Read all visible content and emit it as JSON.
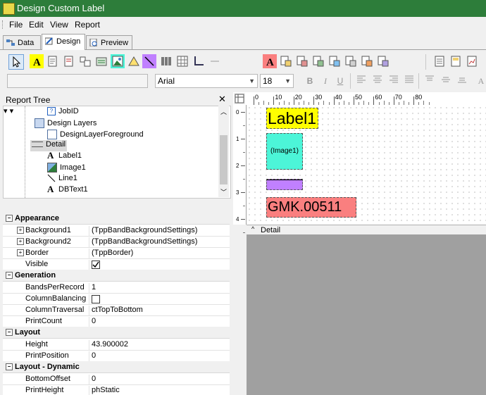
{
  "window": {
    "title": "Design Custom Label"
  },
  "menu": [
    "File",
    "Edit",
    "View",
    "Report"
  ],
  "tabs": [
    {
      "label": "Data",
      "active": false
    },
    {
      "label": "Design",
      "active": true
    },
    {
      "label": "Preview",
      "active": false
    }
  ],
  "format_toolbar": {
    "font_name": "Arial",
    "font_size": "18"
  },
  "report_tree": {
    "header": "Report Tree",
    "nodes": [
      {
        "label": "JobID",
        "icon": "field-icon"
      },
      {
        "label": "Design Layers",
        "icon": "layers-icon"
      },
      {
        "label": "DesignLayerForeground",
        "icon": "layer-icon"
      },
      {
        "label": "Detail",
        "icon": "band-icon"
      },
      {
        "label": "Label1",
        "icon": "label-icon"
      },
      {
        "label": "Image1",
        "icon": "image-icon"
      },
      {
        "label": "Line1",
        "icon": "line-icon"
      },
      {
        "label": "DBText1",
        "icon": "dbtext-icon"
      }
    ]
  },
  "properties": {
    "appearance": {
      "title": "Appearance",
      "rows": [
        {
          "name": "Background1",
          "value": "(TppBandBackgroundSettings)"
        },
        {
          "name": "Background2",
          "value": "(TppBandBackgroundSettings)"
        },
        {
          "name": "Border",
          "value": "(TppBorder)"
        },
        {
          "name": "Visible",
          "value": ""
        }
      ]
    },
    "generation": {
      "title": "Generation",
      "rows": [
        {
          "name": "BandsPerRecord",
          "value": "1"
        },
        {
          "name": "ColumnBalancing",
          "value": ""
        },
        {
          "name": "ColumnTraversal",
          "value": "ctTopToBottom"
        },
        {
          "name": "PrintCount",
          "value": "0"
        }
      ]
    },
    "layout": {
      "title": "Layout",
      "rows": [
        {
          "name": "Height",
          "value": "43.900002"
        },
        {
          "name": "PrintPosition",
          "value": "0"
        }
      ]
    },
    "layout_dynamic": {
      "title": "Layout - Dynamic",
      "rows": [
        {
          "name": "BottomOffset",
          "value": "0"
        },
        {
          "name": "PrintHeight",
          "value": "phStatic"
        }
      ]
    }
  },
  "ruler": {
    "top": [
      "0",
      "10",
      "20",
      "30",
      "40",
      "50",
      "60",
      "70",
      "80"
    ],
    "left": [
      "0",
      "1",
      "2",
      "3",
      "4"
    ]
  },
  "canvas": {
    "label1": "Label1",
    "image1": "(Image1)",
    "dbtext1": "GMK.00511",
    "band_name": "Detail",
    "colors": {
      "label": "#ffff00",
      "image": "#4cf5d8",
      "line": "#c080ff",
      "dbtext": "#fa7f7f"
    }
  }
}
